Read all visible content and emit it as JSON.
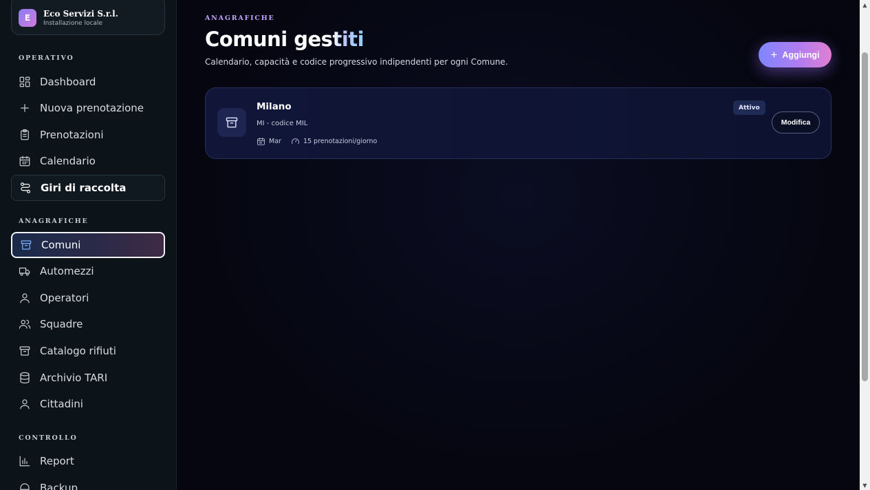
{
  "org": {
    "initial": "E",
    "name": "Eco Servizi S.r.l.",
    "subtitle": "Installazione locale"
  },
  "sidebar": {
    "sections": [
      {
        "title": "OPERATIVO"
      },
      {
        "title": "ANAGRAFICHE"
      },
      {
        "title": "CONTROLLO"
      }
    ],
    "items": [
      {
        "label": "Dashboard",
        "icon": "dashboard-icon"
      },
      {
        "label": "Nuova prenotazione",
        "icon": "plus-icon"
      },
      {
        "label": "Prenotazioni",
        "icon": "clipboard-icon"
      },
      {
        "label": "Calendario",
        "icon": "calendar-icon"
      },
      {
        "label": "Giri di raccolta",
        "icon": "route-icon"
      },
      {
        "label": "Comuni",
        "icon": "archive-box-icon",
        "active": true
      },
      {
        "label": "Automezzi",
        "icon": "truck-icon"
      },
      {
        "label": "Operatori",
        "icon": "user-icon"
      },
      {
        "label": "Squadre",
        "icon": "users-icon"
      },
      {
        "label": "Catalogo rifiuti",
        "icon": "archive-box-icon"
      },
      {
        "label": "Archivio TARI",
        "icon": "database-icon"
      },
      {
        "label": "Cittadini",
        "icon": "user-icon"
      },
      {
        "label": "Report",
        "icon": "bar-chart-icon"
      },
      {
        "label": "Backup",
        "icon": "backup-icon"
      }
    ]
  },
  "header": {
    "eyebrow": "ANAGRAFICHE",
    "title_main": "Comuni ges",
    "title_highlight": "titi",
    "subtitle": "Calendario, capacità e codice progressivo indipendenti per ogni Comune.",
    "add_label": "Aggiungi"
  },
  "comuni": [
    {
      "name": "Milano",
      "code": "MI - codice MIL",
      "day": "Mar",
      "capacity": "15 prenotazioni/giorno",
      "status": "Attivo",
      "edit_label": "Modifica"
    }
  ],
  "colors": {
    "accent_gradient_start": "#7f86ff",
    "accent_gradient_end": "#e07fd2",
    "eyebrow": "#c4a5ff",
    "sidebar_bg": "#0d1419",
    "main_bg": "#05060f"
  }
}
